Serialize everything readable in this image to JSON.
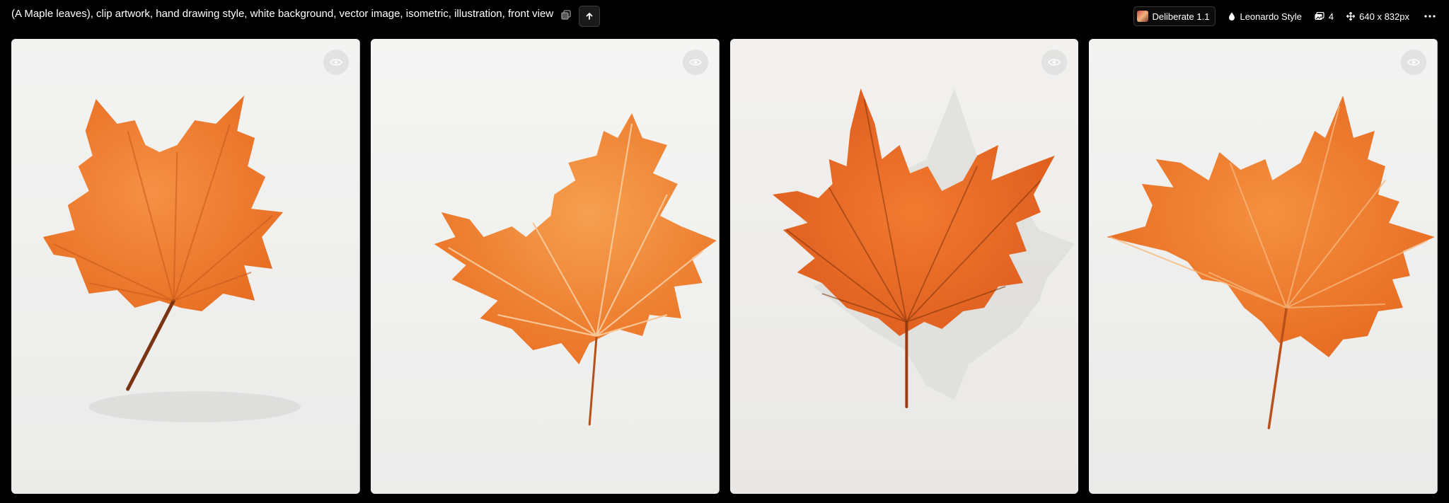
{
  "header": {
    "prompt": "(A Maple leaves), clip artwork, hand drawing style, white background, vector image, isometric, illustration, front view",
    "model_name": "Deliberate 1.1",
    "style_name": "Leonardo Style",
    "image_count": "4",
    "dimensions": "640 x 832px"
  },
  "icons": {
    "copy": "copy-icon",
    "upload": "arrow-up-icon",
    "style": "drop-icon",
    "count": "images-icon",
    "dimensions": "move-arrows-icon",
    "more": "more-dots-icon",
    "view": "eye-icon"
  },
  "colors": {
    "background": "#000000",
    "card_background": "#f1f1f0",
    "leaf_orange": "#f07a2a",
    "leaf_dark": "#c64b12",
    "vein": "#f6b277"
  },
  "gallery": {
    "images": [
      {
        "alt": "",
        "index": 1
      },
      {
        "alt": "",
        "index": 2
      },
      {
        "alt": "",
        "index": 3
      },
      {
        "alt": "",
        "index": 4
      }
    ]
  }
}
